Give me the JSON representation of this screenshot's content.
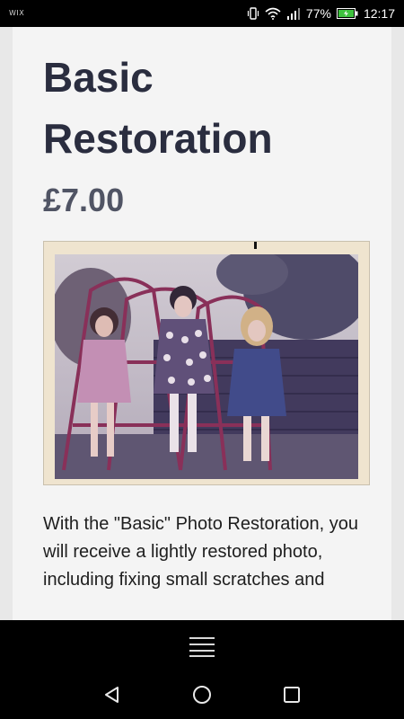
{
  "status_bar": {
    "app_label": "WIX",
    "battery_percent": "77%",
    "time": "12:17",
    "icons": [
      "vibrate-icon",
      "wifi-icon",
      "signal-icon",
      "battery-icon"
    ]
  },
  "product": {
    "title": "Basic Restoration",
    "price": "£7.00",
    "description": "With the \"Basic\" Photo Restoration, you will receive a lightly restored photo, including fixing small scratches and"
  },
  "bottom_bar": {
    "menu_icon": "hamburger-menu-icon"
  },
  "navigation": {
    "icons": [
      "back-icon",
      "home-icon",
      "recent-apps-icon"
    ]
  },
  "colors": {
    "title": "#2a2d3f",
    "price": "#505464",
    "card_background": "#f4f4f4",
    "page_background": "#e8e8e8"
  }
}
